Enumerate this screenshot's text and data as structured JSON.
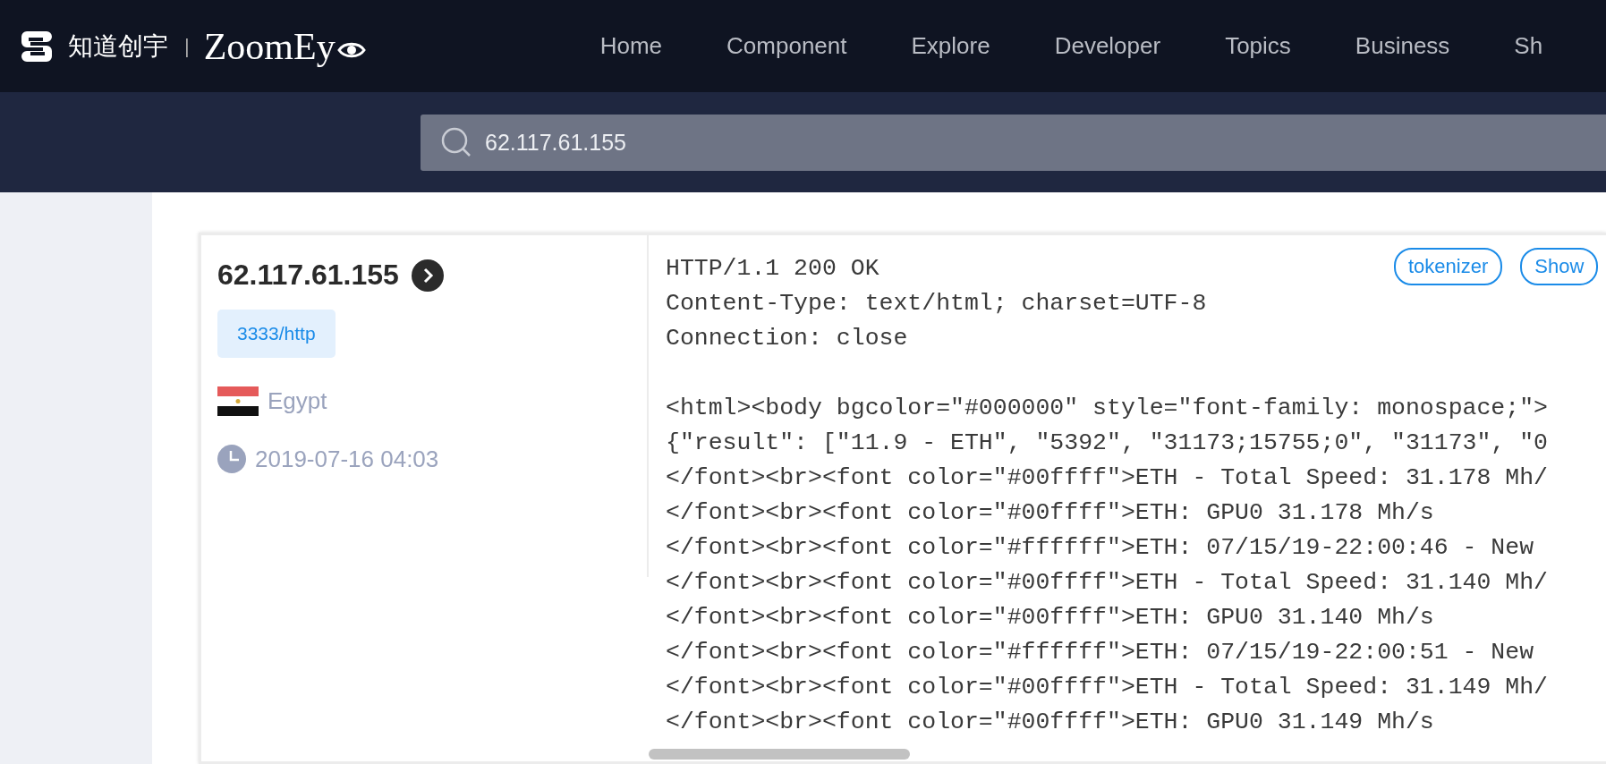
{
  "header": {
    "brand": "知道创宇",
    "separator": "|",
    "product": "ZoomEy",
    "nav": [
      "Home",
      "Component",
      "Explore",
      "Developer",
      "Topics",
      "Business",
      "Sh"
    ]
  },
  "search": {
    "value": "62.117.61.155"
  },
  "result": {
    "ip": "62.117.61.155",
    "port": "3333/http",
    "country": "Egypt",
    "time": "2019-07-16 04:03",
    "buttons": [
      "tokenizer",
      "Show"
    ],
    "banner_blocks": [
      [
        "HTTP/1.1 200 OK",
        "Content-Type: text/html; charset=UTF-8",
        "Connection: close"
      ],
      [
        "<html><body bgcolor=\"#000000\" style=\"font-family: monospace;\">",
        "{\"result\": [\"11.9 - ETH\", \"5392\", \"31173;15755;0\", \"31173\", \"0",
        "</font><br><font color=\"#00ffff\">ETH - Total Speed: 31.178 Mh/",
        "</font><br><font color=\"#00ffff\">ETH: GPU0 31.178 Mh/s",
        "</font><br><font color=\"#ffffff\">ETH: 07/15/19-22:00:46 - New",
        "</font><br><font color=\"#00ffff\">ETH - Total Speed: 31.140 Mh/",
        "</font><br><font color=\"#00ffff\">ETH: GPU0 31.140 Mh/s",
        "</font><br><font color=\"#ffffff\">ETH: 07/15/19-22:00:51 - New",
        "</font><br><font color=\"#00ffff\">ETH - Total Speed: 31.149 Mh/",
        "</font><br><font color=\"#00ffff\">ETH: GPU0 31.149 Mh/s"
      ]
    ]
  }
}
